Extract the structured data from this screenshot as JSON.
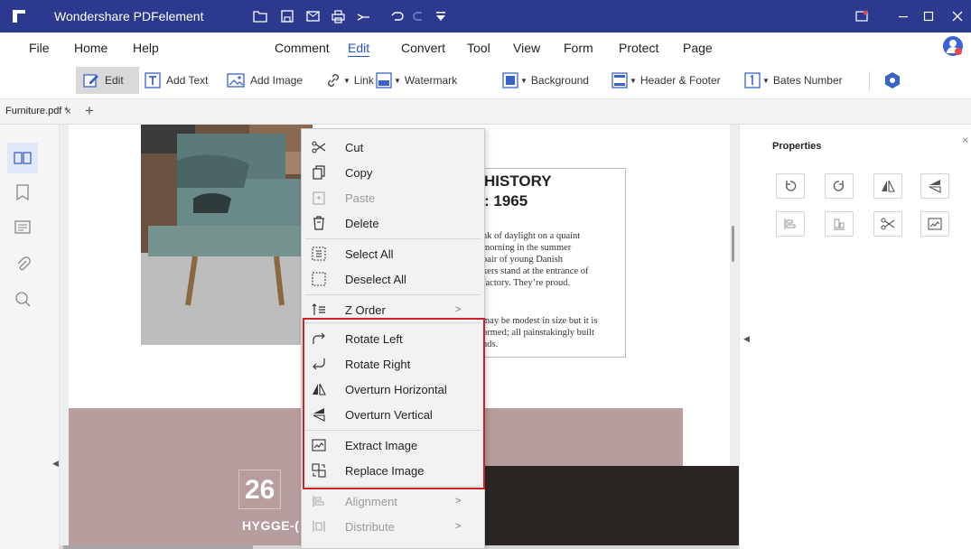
{
  "app": {
    "title": "Wondershare PDFelement",
    "titlebar_color": "#2b3a8e"
  },
  "menu": {
    "items": [
      "File",
      "Home",
      "Help",
      "Comment",
      "Edit",
      "Convert",
      "Tool",
      "View",
      "Form",
      "Protect",
      "Page"
    ],
    "active": "Edit"
  },
  "toolbar": {
    "edit": "Edit",
    "add_text": "Add Text",
    "add_image": "Add Image",
    "link": "Link",
    "watermark": "Watermark",
    "background": "Background",
    "header_footer": "Header & Footer",
    "bates_number": "Bates Number"
  },
  "tab": {
    "name": "Furniture.pdf *",
    "close": "×",
    "add": "+"
  },
  "document": {
    "heading_line1": "HISTORY",
    "heading_line2": ": 1965",
    "para1": [
      "nk of daylight on a quaint",
      "morning in the summer",
      "pair of young Danish",
      "kers stand at the entrance of",
      "factory. They’re proud."
    ],
    "para2": [
      "may be modest in size but it is",
      "ormed; all painstakingly built",
      "nds."
    ],
    "number": "26",
    "subtitle": "HYGGE-("
  },
  "context_menu": {
    "items": [
      {
        "label": "Cut",
        "icon": "scissors-icon",
        "disabled": false
      },
      {
        "label": "Copy",
        "icon": "copy-icon",
        "disabled": false
      },
      {
        "label": "Paste",
        "icon": "paste-icon",
        "disabled": true
      },
      {
        "label": "Delete",
        "icon": "trash-icon",
        "disabled": false
      },
      {
        "label": "Select All",
        "icon": "select-all-icon",
        "disabled": false
      },
      {
        "label": "Deselect All",
        "icon": "deselect-all-icon",
        "disabled": false
      },
      {
        "label": "Z Order",
        "icon": "z-order-icon",
        "disabled": false,
        "submenu": true
      },
      {
        "label": "Rotate Left",
        "icon": "rotate-left-icon",
        "disabled": false
      },
      {
        "label": "Rotate Right",
        "icon": "rotate-right-icon",
        "disabled": false
      },
      {
        "label": "Overturn Horizontal",
        "icon": "flip-horizontal-icon",
        "disabled": false
      },
      {
        "label": "Overturn Vertical",
        "icon": "flip-vertical-icon",
        "disabled": false
      },
      {
        "label": "Extract Image",
        "icon": "extract-image-icon",
        "disabled": false
      },
      {
        "label": "Replace Image",
        "icon": "replace-image-icon",
        "disabled": false
      },
      {
        "label": "Alignment",
        "icon": "alignment-icon",
        "disabled": true,
        "submenu": true
      },
      {
        "label": "Distribute",
        "icon": "distribute-icon",
        "disabled": true,
        "submenu": true
      }
    ],
    "submenu_arrow": ">",
    "highlight_color": "#d0202a"
  },
  "properties": {
    "title": "Properties",
    "close": "×"
  }
}
